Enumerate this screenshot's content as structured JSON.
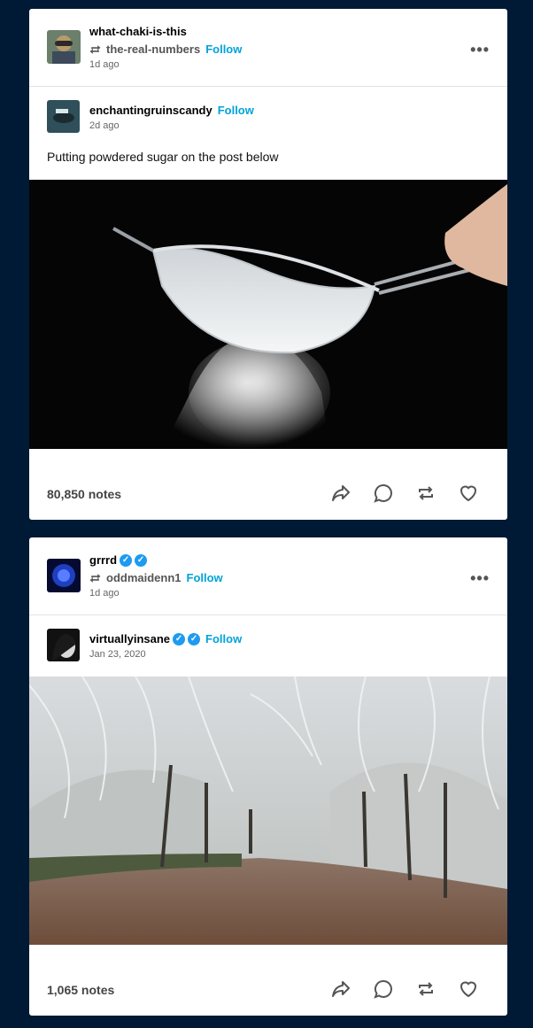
{
  "posts": [
    {
      "reblogger": {
        "name": "what-chaki-is-this",
        "via": "the-real-numbers",
        "follow": "Follow",
        "time": "1d ago"
      },
      "op": {
        "name": "enchantingruinscandy",
        "follow": "Follow",
        "time": "2d ago"
      },
      "caption": "Putting powdered sugar on the post below",
      "image": "sieve-sifting-powdered-sugar-photo",
      "notes": "80,850 notes",
      "more": "•••"
    },
    {
      "reblogger": {
        "name": "grrrd",
        "via": "oddmaidenn1",
        "follow": "Follow",
        "time": "1d ago"
      },
      "op": {
        "name": "virtuallyinsane",
        "follow": "Follow",
        "time": "Jan 23, 2020"
      },
      "image": "frosted-trees-dirt-road-photo",
      "notes": "1,065 notes",
      "more": "•••"
    }
  ],
  "colors": {
    "background": "#001935",
    "follow": "#00a3d9",
    "verified": "#1d9bf0"
  },
  "icons": [
    "reblog-icon",
    "share-icon",
    "reply-icon",
    "like-icon",
    "more-icon",
    "verified-badge-icon"
  ]
}
